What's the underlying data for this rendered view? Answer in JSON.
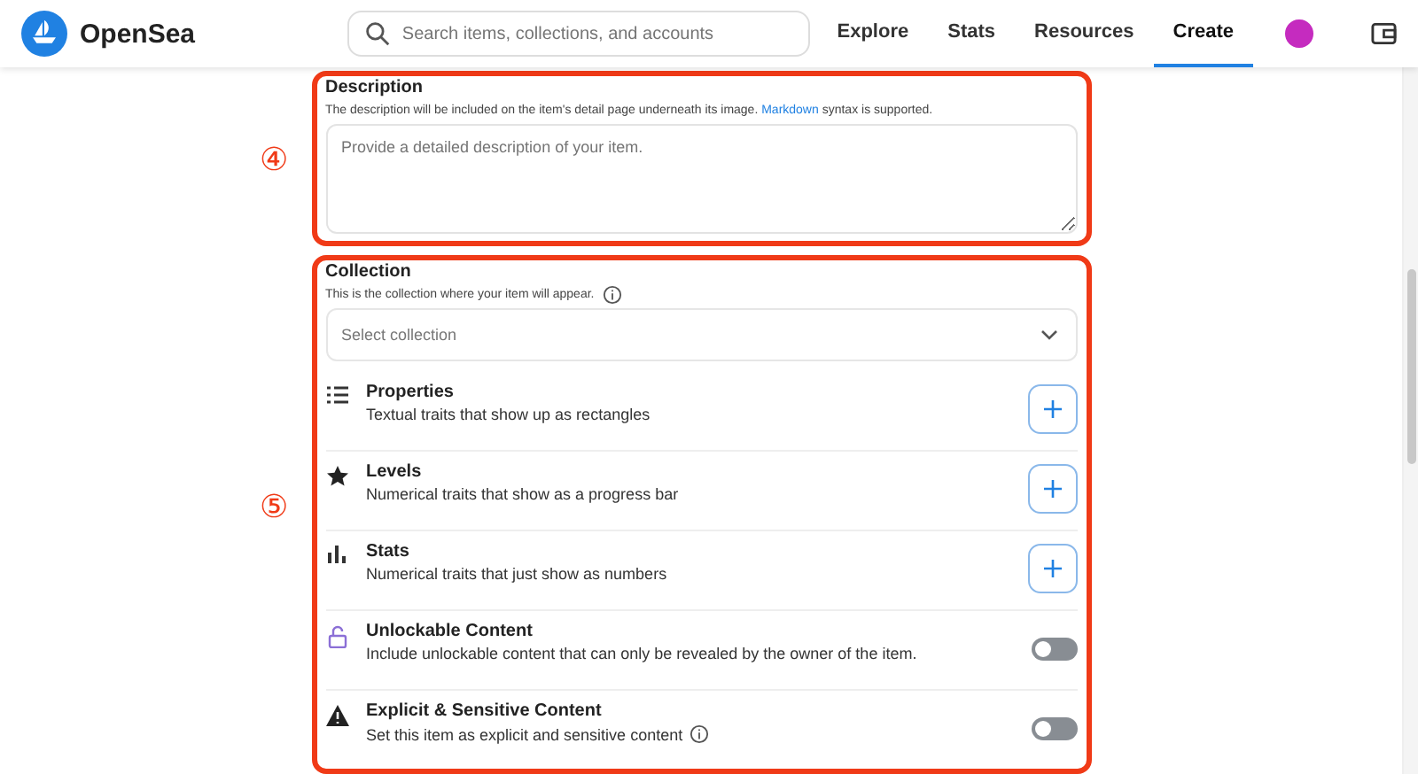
{
  "header": {
    "brand": "OpenSea",
    "search": {
      "placeholder": "Search items, collections, and accounts"
    },
    "nav": [
      {
        "label": "Explore",
        "selected": false
      },
      {
        "label": "Stats",
        "selected": false
      },
      {
        "label": "Resources",
        "selected": false
      },
      {
        "label": "Create",
        "selected": true
      }
    ]
  },
  "description": {
    "marker": "④",
    "title": "Description",
    "hint_before": "The description will be included on the item's detail page underneath its image.",
    "hint_link": "Markdown",
    "hint_after": "syntax is supported.",
    "placeholder": "Provide a detailed description of your item."
  },
  "collection": {
    "marker": "⑤",
    "title": "Collection",
    "hint": "This is the collection where your item will appear.",
    "select_placeholder": "Select collection"
  },
  "options": [
    {
      "kind": "add",
      "title": "Properties",
      "text": "Textual traits that show up as rectangles",
      "info": false
    },
    {
      "kind": "add",
      "title": "Levels",
      "text": "Numerical traits that show as a progress bar",
      "info": false
    },
    {
      "kind": "add",
      "title": "Stats",
      "text": "Numerical traits that just show as numbers",
      "info": false
    },
    {
      "kind": "toggle",
      "title": "Unlockable Content",
      "text": "Include unlockable content that can only be revealed by the owner of the item.",
      "on": false,
      "info": false
    },
    {
      "kind": "toggle",
      "title": "Explicit & Sensitive Content",
      "text": "Set this item as explicit and sensitive content",
      "on": false,
      "info": true
    }
  ]
}
